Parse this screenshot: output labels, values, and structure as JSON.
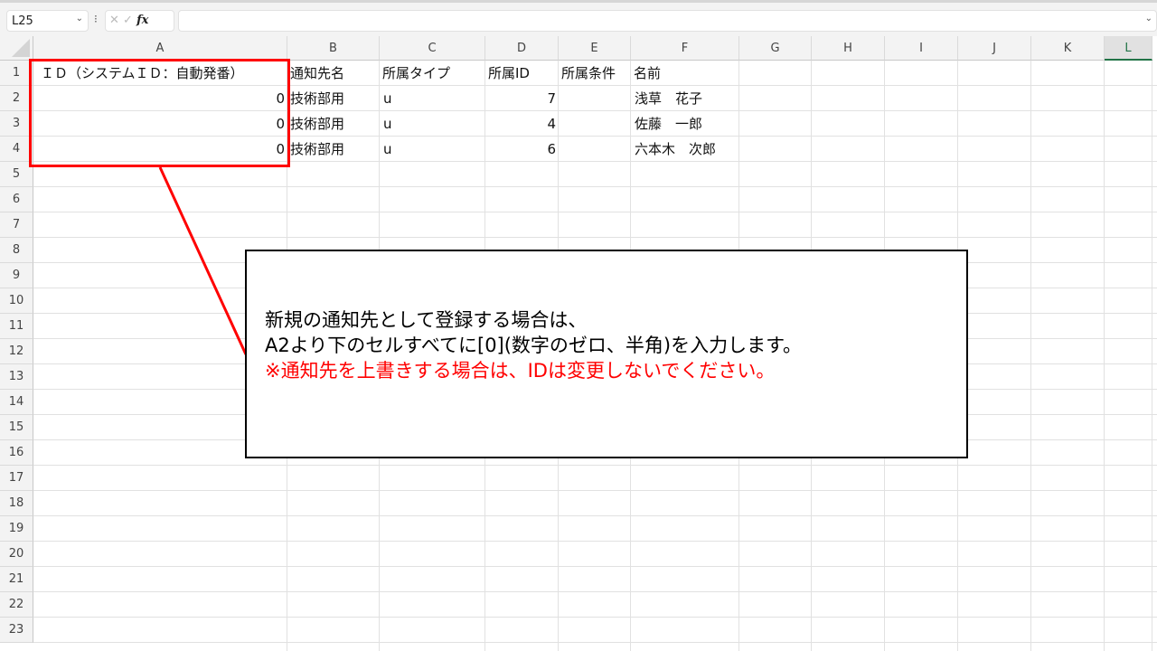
{
  "toolbar": {
    "name_box": "L25",
    "fx_label": "fx",
    "cancel": "✕",
    "confirm": "✓",
    "formula_value": ""
  },
  "columns": [
    "A",
    "B",
    "C",
    "D",
    "E",
    "F",
    "G",
    "H",
    "I",
    "J",
    "K",
    "L"
  ],
  "selected_column": "L",
  "rows": [
    "1",
    "2",
    "3",
    "4",
    "5",
    "6",
    "7",
    "8",
    "9",
    "10",
    "11",
    "12",
    "13",
    "14",
    "15",
    "16",
    "17",
    "18",
    "19",
    "20",
    "21",
    "22",
    "23"
  ],
  "headers": {
    "a": "ＩＤ（システムＩＤ：自動発番）",
    "b": "通知先名",
    "c": "所属タイプ",
    "d": "所属ID",
    "e": "所属条件",
    "f": "名前"
  },
  "data_rows": [
    {
      "a": "0",
      "b": "技術部用",
      "c": "u",
      "d": "7",
      "e": "",
      "f": "浅草　花子"
    },
    {
      "a": "0",
      "b": "技術部用",
      "c": "u",
      "d": "4",
      "e": "",
      "f": "佐藤　一郎"
    },
    {
      "a": "0",
      "b": "技術部用",
      "c": "u",
      "d": "6",
      "e": "",
      "f": "六本木　次郎"
    }
  ],
  "callout": {
    "line1": "新規の通知先として登録する場合は、",
    "line2": "A2より下のセルすべてに[0](数字のゼロ、半角)を入力します。",
    "line3": "※通知先を上書きする場合は、IDは変更しないでください。"
  },
  "colors": {
    "highlight": "#ff0000",
    "accent": "#217346"
  }
}
